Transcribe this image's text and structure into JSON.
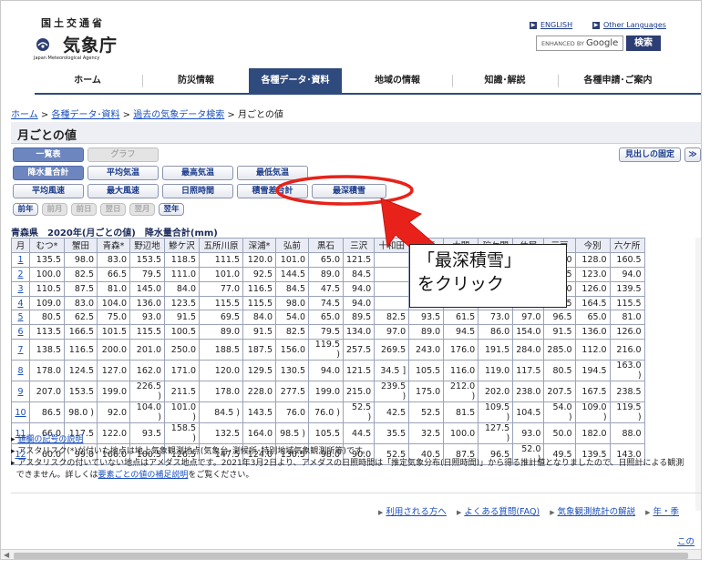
{
  "header": {
    "ministry": "国土交通省",
    "agency": "気象庁",
    "agency_en": "Japan Meteorological Agency",
    "lang_english": "ENGLISH",
    "lang_other": "Other Languages",
    "search_placeholder": "ENHANCED BY",
    "search_brand": "Google",
    "search_button": "検索"
  },
  "nav": {
    "items": [
      "ホーム",
      "防災情報",
      "各種データ･資料",
      "地域の情報",
      "知識･解説",
      "各種申請･ご案内"
    ],
    "active_index": 2,
    "active_color": "#2f4a7d"
  },
  "breadcrumb": {
    "items": [
      "ホーム",
      "各種データ･資料",
      "過去の気象データ検索"
    ],
    "separator": ">",
    "current": "月ごとの値"
  },
  "page_title": "月ごとの値",
  "view_tabs": [
    "一覧表",
    "グラフ"
  ],
  "fixed_heading_button": "見出しの固定",
  "elements": {
    "row1": [
      "降水量合計",
      "平均気温",
      "最高気温",
      "最低気温"
    ],
    "row2": [
      "平均風速",
      "最大風速",
      "日照時間",
      "積雪差合計",
      "最深積雪"
    ],
    "selected": "降水量合計"
  },
  "year_nav": [
    "前年",
    "前月",
    "前日",
    "翌日",
    "翌月",
    "翌年"
  ],
  "table": {
    "title": "青森県　2020年(月ごとの値)　降水量合計(mm)",
    "header": [
      "月",
      "むつ*",
      "蟹田",
      "青森*",
      "野辺地",
      "鰺ケ沢",
      "五所川原",
      "深浦*",
      "弘前",
      "黒石",
      "三沢",
      "十和田",
      "八戸",
      "大間",
      "碇ケ関",
      "休屋",
      "三戸",
      "今別",
      "六ケ所"
    ],
    "rows": [
      [
        "1",
        "135.5",
        "98.0",
        "83.0",
        "153.5",
        "118.5",
        "111.5",
        "120.0",
        "101.0",
        "65.0",
        "121.5",
        "",
        "",
        "",
        "",
        "82.5",
        "122.0",
        "128.0",
        "160.5"
      ],
      [
        "2",
        "100.0",
        "82.5",
        "66.5",
        "79.5",
        "111.0",
        "101.0",
        "92.5",
        "144.5",
        "89.0",
        "84.5",
        "",
        "",
        "",
        "",
        "05.5",
        "78.5",
        "123.0",
        "94.0"
      ],
      [
        "3",
        "110.5",
        "87.5",
        "81.0",
        "145.0",
        "84.0",
        "77.0",
        "116.5",
        "84.5",
        "47.5",
        "94.0",
        "",
        "",
        "",
        "",
        "73.5",
        "56.0",
        "126.0",
        "139.5"
      ],
      [
        "4",
        "109.0",
        "83.0",
        "104.0",
        "136.0",
        "123.5",
        "115.5",
        "115.5",
        "98.0",
        "74.5",
        "94.0",
        "",
        "",
        "",
        "",
        "00.5",
        "107.5",
        "164.5",
        "115.5"
      ],
      [
        "5",
        "80.5",
        "62.5",
        "75.0",
        "93.0",
        "91.5",
        "69.5",
        "84.0",
        "54.0",
        "65.0",
        "89.5",
        "82.5",
        "93.5",
        "61.5",
        "73.0",
        "97.0",
        "96.5",
        "65.0",
        "81.0"
      ],
      [
        "6",
        "113.5",
        "166.5",
        "101.5",
        "115.5",
        "100.5",
        "89.0",
        "91.5",
        "82.5",
        "79.5",
        "134.0",
        "97.0",
        "89.0",
        "94.5",
        "86.0",
        "154.0",
        "91.5",
        "136.0",
        "126.0"
      ],
      [
        "7",
        "138.5",
        "116.5",
        "200.0",
        "201.0",
        "250.0",
        "188.5",
        "187.5",
        "156.0",
        "119.5 )",
        "257.5",
        "269.5",
        "243.0",
        "176.0",
        "191.5",
        "284.0",
        "285.0",
        "112.0",
        "216.0"
      ],
      [
        "8",
        "178.0",
        "124.5",
        "127.0",
        "162.0",
        "171.0",
        "120.0",
        "129.5",
        "130.5",
        "94.0",
        "121.5",
        "34.5 ]",
        "105.5",
        "116.0",
        "119.0",
        "117.5",
        "80.5",
        "194.5",
        "163.0 )"
      ],
      [
        "9",
        "207.0",
        "153.5",
        "199.0",
        "226.5 )",
        "211.5",
        "178.0",
        "228.0",
        "277.5",
        "199.0",
        "215.0",
        "239.5 )",
        "175.0",
        "212.0 )",
        "202.0",
        "238.0",
        "207.5",
        "167.5",
        "238.5"
      ],
      [
        "10",
        "86.5",
        "98.0 )",
        "92.0",
        "104.0 )",
        "101.0 )",
        "84.5 )",
        "143.5",
        "76.0",
        "76.0 )",
        "52.5 )",
        "42.5",
        "52.5",
        "81.5",
        "109.5 )",
        "104.5",
        "54.0 )",
        "109.0 )",
        "119.5 )"
      ],
      [
        "11",
        "66.0",
        "117.5",
        "122.0",
        "93.5",
        "158.5 )",
        "132.5",
        "164.0",
        "98.5 )",
        "105.5",
        "44.5",
        "35.5",
        "32.5",
        "100.0",
        "127.5 )",
        "93.0",
        "50.0",
        "182.0",
        "88.0"
      ],
      [
        "12",
        "60.0",
        "99.0",
        "166.0",
        "100.5",
        "126.5",
        "147.5",
        "124.0",
        "130.5",
        "98.0",
        "90.0",
        "52.5",
        "40.5",
        "87.5",
        "96.5",
        "52.0 )",
        "49.5",
        "139.5",
        "143.0"
      ]
    ]
  },
  "notes": {
    "link": "値欄の記号の説明",
    "line2": "アスタリスク(*)が付いた地点は地上気象観測地点(気象台･測候所･特別地域気象観測所等)です。",
    "line3a": "アスタリスクの付いていない地点はアメダス地点です。2021年3月2日より、アメダスの日照時間は「推定気象分布(日照時間)」から得る推計値となりましたので、日照計による観測",
    "line3b_pre": "できません。詳しくは",
    "line3b_link": "要素ごとの値の補足説明",
    "line3b_post": "をご覧ください。"
  },
  "footer": {
    "links": [
      "利用される方へ",
      "よくある質問(FAQ)",
      "気象観測統計の解説",
      "年・季"
    ],
    "more": "この"
  },
  "annotation": {
    "callout_line1": "「最深積雪」",
    "callout_line2": "をクリック",
    "color": "#e8221a"
  }
}
